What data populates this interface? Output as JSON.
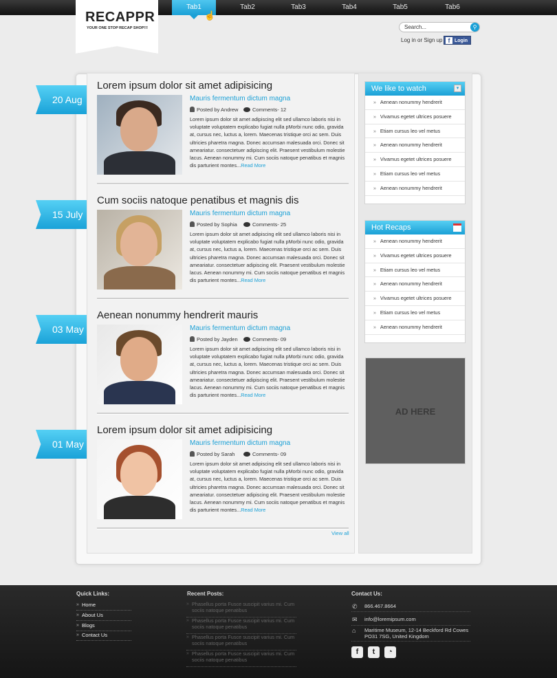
{
  "nav": {
    "tabs": [
      "Tab1",
      "Tab2",
      "Tab3",
      "Tab4",
      "Tab5",
      "Tab6"
    ]
  },
  "logo": {
    "title": "RECAPPR",
    "tagline": "YOUR ONE STOP RECAP SHOP!!!"
  },
  "header": {
    "search_placeholder": "Search...",
    "login_text": "Log in or Sign up",
    "fb_login": "Login"
  },
  "posts": [
    {
      "date": "20 Aug",
      "title": "Lorem ipsum dolor sit amet adipisicing",
      "subtitle": "Mauris fermentum dictum magna",
      "author": "Posted by Andrew",
      "comments": "Comments- 12",
      "body": "Lorem ipsum dolor sit amet adipiscing elit sed ullamco laboris nisi in voluptate voluptatem explicabo fugiat nulla pMorbi nunc odio, gravida at, cursus nec, luctus a, lorem. Maecenas tristique orci ac sem. Duis ultricies pharetra magna. Donec accumsan malesuada orci. Donec sit ameariatur. consectetuer adipiscing elit. Praesent vestibulum molestie lacus. Aenean nonummy mi. Cum sociis natoque penatibus et magnis dis parturient montes",
      "more": "Read More"
    },
    {
      "date": "15 July",
      "title": "Cum sociis natoque penatibus et magnis dis",
      "subtitle": "Mauris fermentum dictum magna",
      "author": "Posted by Sophia",
      "comments": "Comments- 25",
      "body": "Lorem ipsum dolor sit amet adipiscing elit sed ullamco laboris nisi in voluptate voluptatem explicabo fugiat nulla pMorbi nunc odio, gravida at, cursus nec, luctus a, lorem. Maecenas tristique orci ac sem. Duis ultricies pharetra magna. Donec accumsan malesuada orci. Donec sit ameariatur. consectetuer adipiscing elit. Praesent vestibulum molestie lacus. Aenean nonummy mi. Cum sociis natoque penatibus et magnis dis parturient montes",
      "more": "Read More"
    },
    {
      "date": "03 May",
      "title": "Aenean nonummy hendrerit mauris",
      "subtitle": "Mauris fermentum dictum magna",
      "author": "Posted by Jayden",
      "comments": "Comments- 09",
      "body": "Lorem ipsum dolor sit amet adipiscing elit sed ullamco laboris nisi in voluptate voluptatem explicabo fugiat nulla pMorbi nunc odio, gravida at, cursus nec, luctus a, lorem. Maecenas tristique orci ac sem. Duis ultricies pharetra magna. Donec accumsan malesuada orci. Donec sit ameariatur. consectetuer adipiscing elit. Praesent vestibulum molestie lacus. Aenean nonummy mi. Cum sociis natoque penatibus et magnis dis parturient montes",
      "more": "Read More"
    },
    {
      "date": "01 May",
      "title": "Lorem ipsum dolor sit amet adipisicing",
      "subtitle": "Mauris fermentum dictum magna",
      "author": "Posted by Sarah",
      "comments": "Comments- 09",
      "body": "Lorem ipsum dolor sit amet adipiscing elit sed ullamco laboris nisi in voluptate voluptatem explicabo fugiat nulla pMorbi nunc odio, gravida at, cursus nec, luctus a, lorem. Maecenas tristique orci ac sem. Duis ultricies pharetra magna. Donec accumsan malesuada orci. Donec sit ameariatur. consectetuer adipiscing elit. Praesent vestibulum molestie lacus. Aenean nonummy mi. Cum sociis natoque penatibus et magnis dis parturient montes",
      "more": "Read More"
    }
  ],
  "view_all": "View all",
  "widgets": {
    "watch": {
      "title": "We like to watch",
      "items": [
        "Aenean nonummy hendrerit",
        "Vivamus egetet ultrices posuere",
        "Etiam cursus leo vel metus",
        "Aenean nonummy hendrerit",
        "Vivamus egetet ultrices posuere",
        "Etiam cursus leo vel metus",
        "Aenean nonummy hendrerit"
      ]
    },
    "hot": {
      "title": "Hot Recaps",
      "items": [
        "Aenean nonummy hendrerit",
        "Vivamus egetet ultrices posuere",
        "Etiam cursus leo vel metus",
        "Aenean nonummy hendrerit",
        "Vivamus egetet ultrices posuere",
        "Etiam cursus leo vel metus",
        "Aenean nonummy hendrerit"
      ]
    },
    "ad": "AD HERE"
  },
  "footer": {
    "quick_links_title": "Quick Links:",
    "quick_links": [
      "Home",
      "About Us",
      "Blogs",
      "Contact Us"
    ],
    "recent_title": "Recent Posts:",
    "recent": [
      "Phasellus porta Fusce suscipit varius mi. Cum sociis natoque penatibus",
      "Phasellus porta Fusce suscipit varius mi. Cum sociis natoque penatibus",
      "Phasellus porta Fusce suscipit varius mi. Cum sociis natoque penatibus",
      "Phasellus porta Fusce suscipit varius mi. Cum sociis natoque penatibus"
    ],
    "contact_title": "Contact Us:",
    "phone": "866.467.8664",
    "email": "info@loremipsum.com",
    "address": "Maritime Museum, 12-14 Beckford Rd Cowes PO31 7SG, United Kingdom",
    "social": [
      "facebook-icon",
      "twitter-icon",
      "rss-icon"
    ]
  },
  "colors": {
    "accent": "#1aa0d6",
    "dark": "#151515"
  }
}
